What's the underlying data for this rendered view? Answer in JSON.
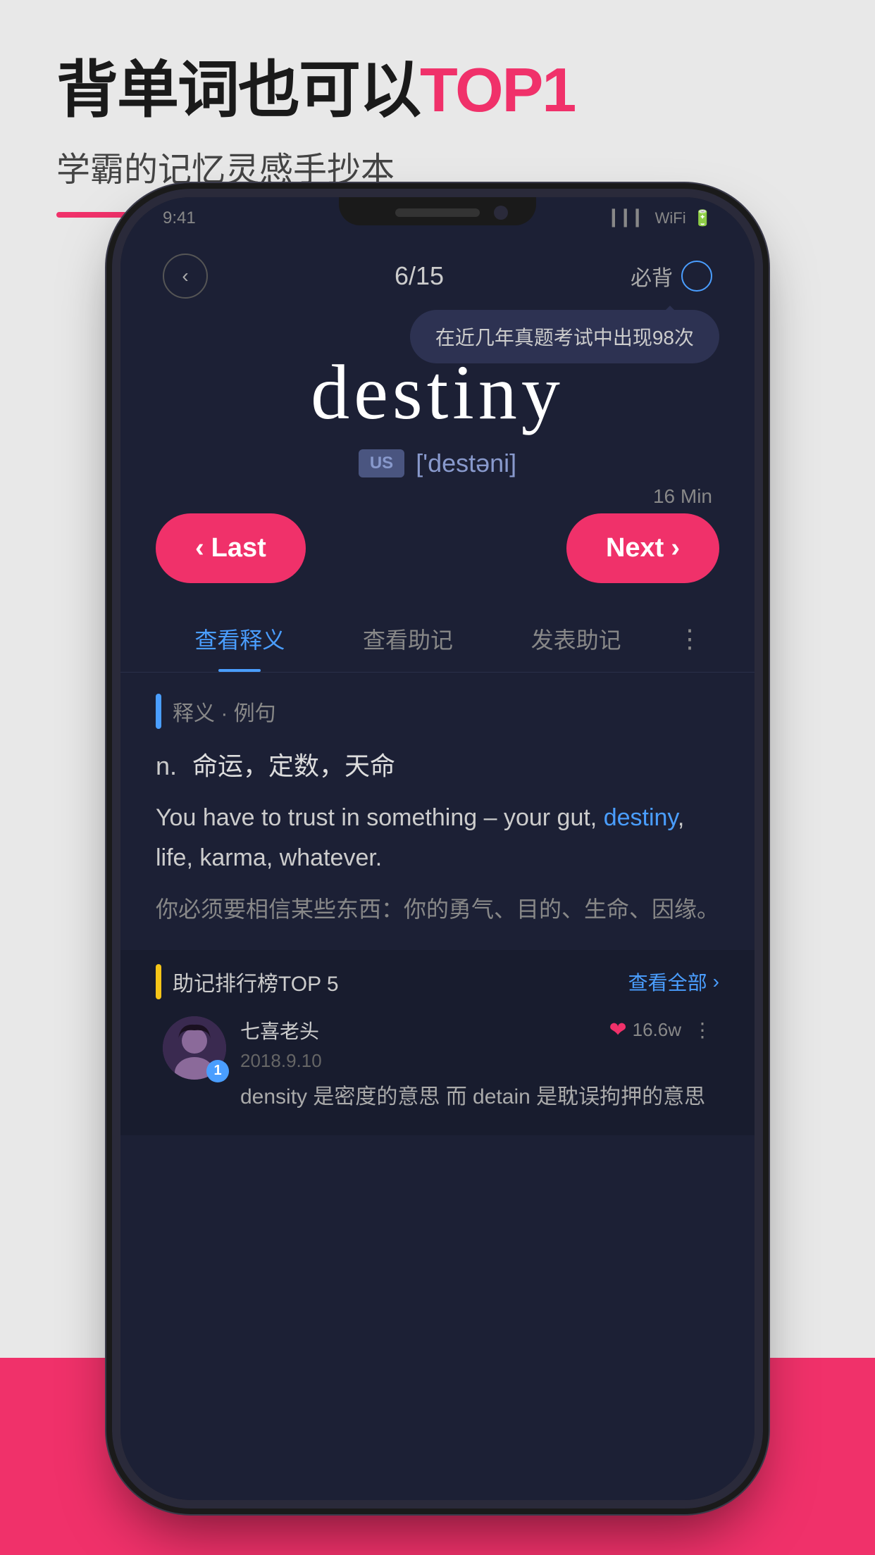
{
  "header": {
    "title_part1": "背单词也可以",
    "title_highlight": "TOP1",
    "subtitle": "学霸的记忆灵感手抄本"
  },
  "phone": {
    "progress": "6/15",
    "must_learn_label": "必背",
    "tooltip": "在近几年真题考试中出现98次",
    "word": "destiny",
    "pronunciation_badge": "US",
    "phonetic": "['destəni]",
    "time_label": "16 Min",
    "btn_last": "< Last",
    "btn_next": "Next >",
    "tabs": [
      {
        "label": "查看释义",
        "active": true
      },
      {
        "label": "查看助记",
        "active": false
      },
      {
        "label": "发表助记",
        "active": false
      }
    ],
    "section_label": "释义 · 例句",
    "definition": {
      "pos": "n.",
      "meanings": "命运，定数，天命",
      "example_en": "You have to trust in something – your gut, destiny, life, karma, whatever.",
      "example_word": "destiny",
      "example_zh": "你必须要相信某些东西：你的勇气、目的、生命、因缘。"
    },
    "mnemonic": {
      "title": "助记排行榜TOP 5",
      "view_all": "查看全部",
      "top_user": {
        "name": "七喜老头",
        "date": "2018.9.10",
        "rank": "1",
        "likes": "16.6w",
        "comment": "density 是密度的意思 而 detain 是耽误拘押的意思"
      }
    }
  }
}
